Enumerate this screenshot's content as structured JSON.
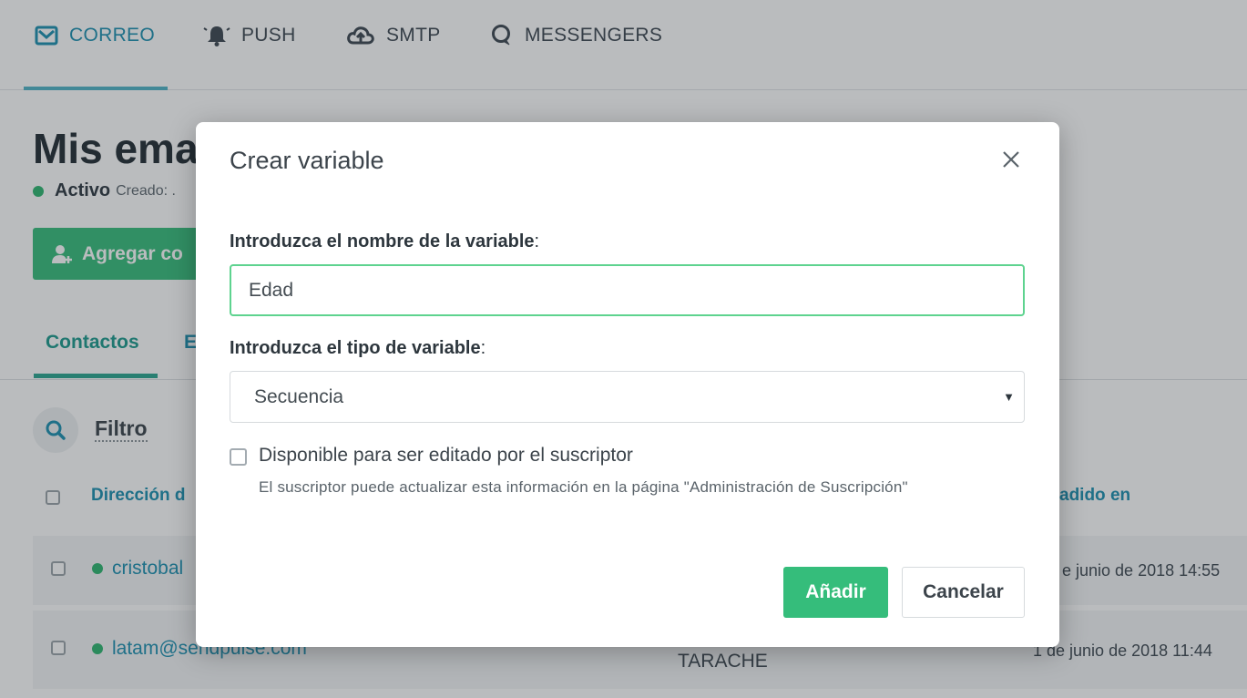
{
  "nav": {
    "items": [
      {
        "label": "CORREO",
        "icon": "envelope-icon"
      },
      {
        "label": "PUSH",
        "icon": "bell-icon"
      },
      {
        "label": "SMTP",
        "icon": "cloud-upload-icon"
      },
      {
        "label": "MESSENGERS",
        "icon": "chat-bubble-icon"
      }
    ],
    "active": "CORREO"
  },
  "page": {
    "title": "Mis ema",
    "status_label": "Activo",
    "status_sub": "Creado: .",
    "add_button": "Agregar co",
    "tabs": [
      {
        "label": "Contactos",
        "active": true
      },
      {
        "label": "E",
        "active": false
      }
    ],
    "filter_label": "Filtro",
    "columns": {
      "email": "Dirección d",
      "added": "adido en"
    },
    "rows": [
      {
        "email": "cristobal",
        "date": "e junio de 2018 14:55",
        "tag": ""
      },
      {
        "email": "latam@sendpulse.com",
        "date": "1 de junio de 2018 11:44",
        "tag": "TARACHE"
      }
    ]
  },
  "modal": {
    "title": "Crear variable",
    "name_label_bold": "Introduzca el nombre de la variable",
    "name_label_suffix": ":",
    "name_value": "Edad",
    "type_label_bold": "Introduzca el tipo de variable",
    "type_label_suffix": ":",
    "type_value": "Secuencia",
    "editable_checked": false,
    "editable_label": "Disponible para ser editado por el suscriptor",
    "editable_help": "El suscriptor puede actualizar esta información en la página \"Administración de Suscripción\"",
    "add_button": "Añadir",
    "cancel_button": "Cancelar"
  },
  "colors": {
    "accent_green": "#35bd7b",
    "link_blue": "#1b8fb0",
    "input_focus": "#5ed38f"
  }
}
